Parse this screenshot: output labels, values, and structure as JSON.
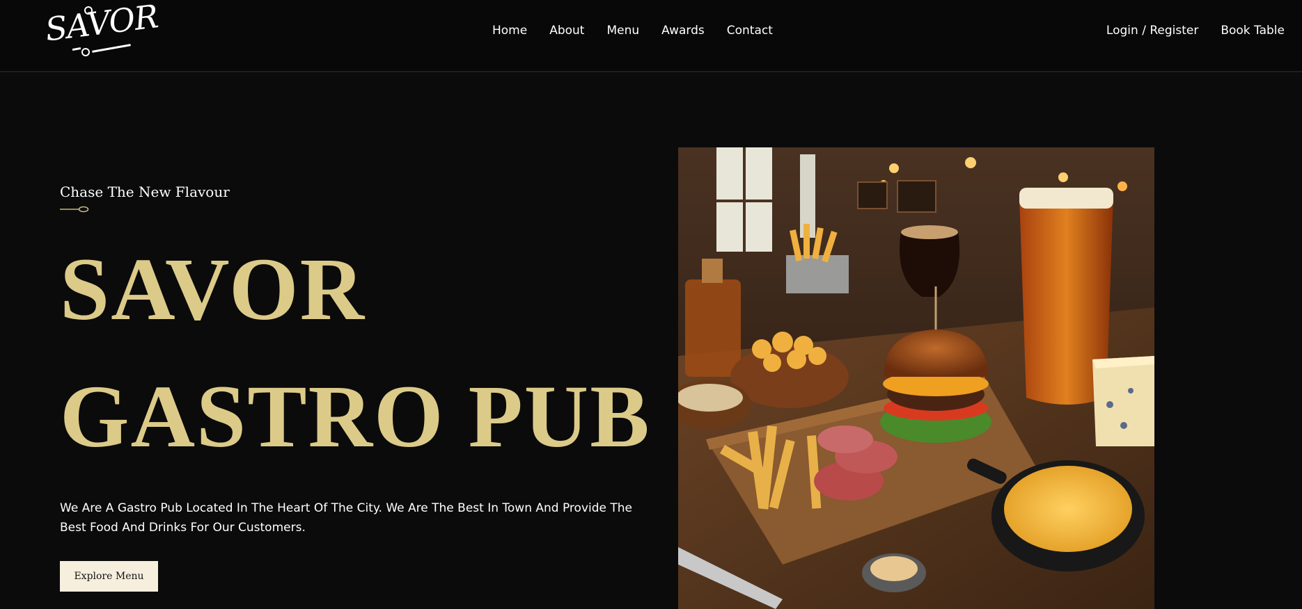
{
  "brand": {
    "logo_text": "SAVOR"
  },
  "nav": {
    "items": [
      "Home",
      "About",
      "Menu",
      "Awards",
      "Contact"
    ],
    "right": [
      "Login / Register",
      "Book Table"
    ]
  },
  "hero": {
    "tagline": "Chase The New Flavour",
    "title_line1": "SAVOR",
    "title_line2": "GASTRO PUB",
    "description": "We Are A Gastro Pub Located In The Heart Of The City. We Are The Best In Town And Provide The Best Food And Drinks For Our Customers.",
    "cta_label": "Explore Menu",
    "accent_color": "#dcca89"
  }
}
